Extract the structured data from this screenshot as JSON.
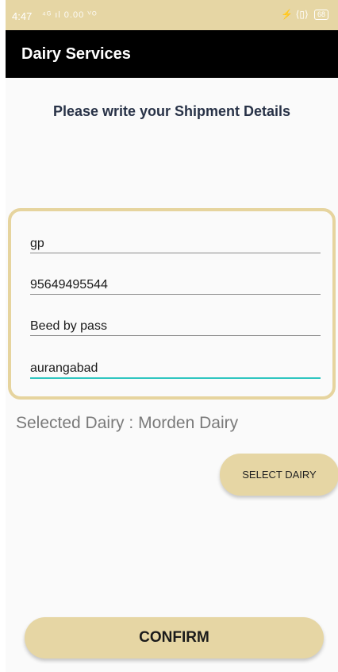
{
  "status_bar": {
    "time": "4:47",
    "signal_text": "⁴ᴳ ıl 0.00 ⱽᴼ",
    "battery": "68"
  },
  "app_bar": {
    "title": "Dairy Services"
  },
  "subtitle": "Please write your Shipment Details",
  "form": {
    "name_value": "gp",
    "phone_value": "95649495544",
    "address_value": "Beed by pass",
    "city_value": "aurangabad"
  },
  "selected_dairy": {
    "label": "Selected Dairy :",
    "value": "Morden Dairy"
  },
  "buttons": {
    "select_dairy": "SELECT DAIRY",
    "confirm": "CONFIRM"
  },
  "colors": {
    "accent": "#e6d6a4",
    "app_bar": "#000000",
    "focus_underline": "#2fc6c0"
  }
}
